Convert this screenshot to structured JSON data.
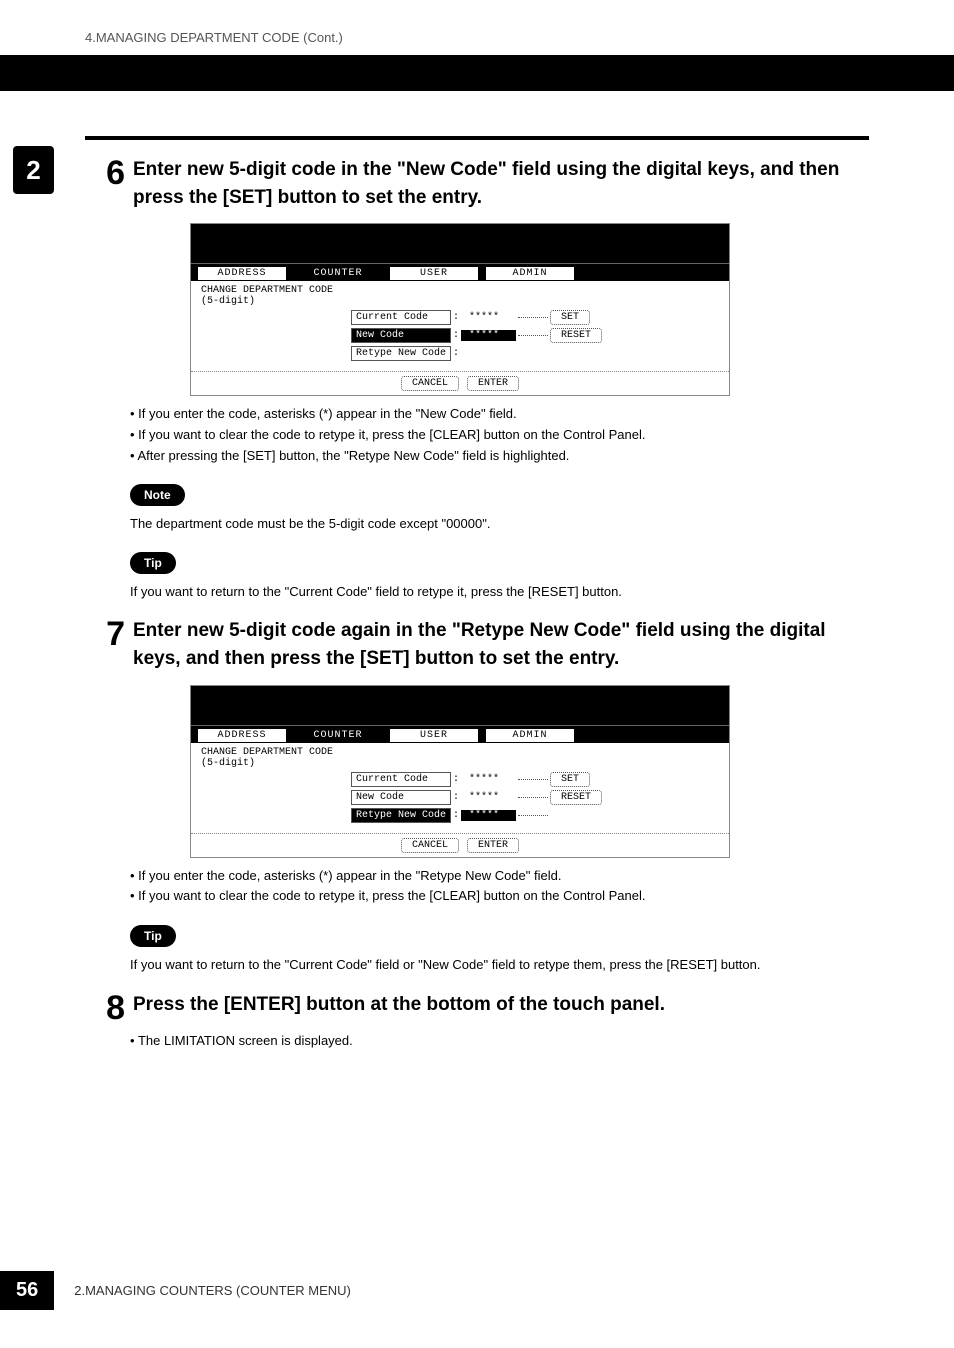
{
  "header": {
    "breadcrumb": "4.MANAGING DEPARTMENT CODE (Cont.)"
  },
  "chapter_tab": "2",
  "steps": [
    {
      "num": "6",
      "title": "Enter new 5-digit code in the \"New Code\" field using the digital keys, and then press the [SET] button to set the entry.",
      "bullets": [
        "If you enter the code, asterisks (*) appear in the \"New Code\" field.",
        "If you want to clear the code to retype it, press the [CLEAR] button on the Control Panel.",
        "After pressing the [SET] button, the \"Retype New Code\" field is highlighted."
      ]
    },
    {
      "num": "7",
      "title": "Enter new 5-digit code again in the \"Retype New Code\" field using the digital keys, and then press the [SET] button to set the entry.",
      "bullets": [
        "If you enter the code, asterisks (*) appear in the \"Retype New Code\" field.",
        "If you want to clear the code to retype it, press the [CLEAR] button on the Control Panel."
      ]
    },
    {
      "num": "8",
      "title": "Press the [ENTER] button at the bottom of the touch panel.",
      "bullets": [
        "The LIMITATION screen is displayed."
      ]
    }
  ],
  "callouts": {
    "note_label": "Note",
    "note_text": "The department code must be the 5-digit code except \"00000\".",
    "tip_label": "Tip",
    "tip1_text": "If you want to return to the \"Current Code\" field to retype it, press the [RESET] button.",
    "tip2_text": "If you want to return to the \"Current Code\" field or \"New Code\" field to retype them, press the [RESET] button."
  },
  "screenshot": {
    "tabs": [
      "ADDRESS",
      "COUNTER",
      "USER",
      "ADMIN"
    ],
    "heading": "CHANGE DEPARTMENT CODE\n(5-digit)",
    "fields": {
      "current": "Current Code",
      "new": "New Code",
      "retype": "Retype New Code"
    },
    "mask": "*****",
    "buttons": {
      "set": "SET",
      "reset": "RESET",
      "cancel": "CANCEL",
      "enter": "ENTER"
    }
  },
  "footer": {
    "page": "56",
    "text": "2.MANAGING COUNTERS (COUNTER MENU)"
  }
}
